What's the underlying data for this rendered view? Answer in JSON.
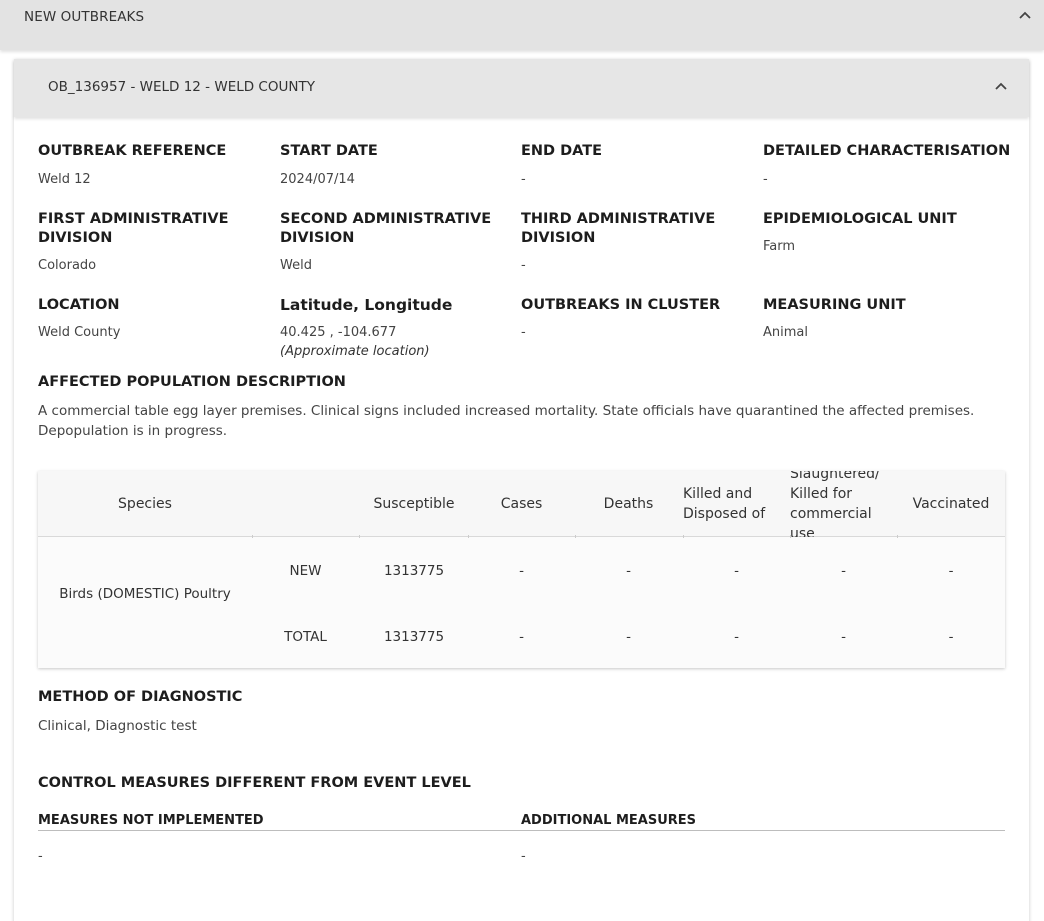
{
  "top_panel": {
    "title": "NEW OUTBREAKS",
    "icon": "chevron-up-icon"
  },
  "outbreak_panel": {
    "title": "OB_136957 - WELD 12 - WELD COUNTY",
    "icon": "chevron-up-icon"
  },
  "fields": {
    "outbreak_reference": {
      "label": "OUTBREAK REFERENCE",
      "value": "Weld 12"
    },
    "start_date": {
      "label": "START DATE",
      "value": "2024/07/14"
    },
    "end_date": {
      "label": "END DATE",
      "value": "-"
    },
    "detailed_characterisation": {
      "label": "DETAILED CHARACTERISATION",
      "value": "-"
    },
    "first_admin": {
      "label": "FIRST ADMINISTRATIVE DIVISION",
      "value": "Colorado"
    },
    "second_admin": {
      "label": "SECOND ADMINISTRATIVE DIVISION",
      "value": "Weld"
    },
    "third_admin": {
      "label": "THIRD ADMINISTRATIVE DIVISION",
      "value": "-"
    },
    "epi_unit": {
      "label": "EPIDEMIOLOGICAL UNIT",
      "value": "Farm"
    },
    "location": {
      "label": "LOCATION",
      "value": "Weld County"
    },
    "lat_long": {
      "label": "Latitude, Longitude",
      "value": "40.425 , -104.677",
      "note": "(Approximate location)"
    },
    "outbreaks_in_cluster": {
      "label": "OUTBREAKS IN CLUSTER",
      "value": "-"
    },
    "measuring_unit": {
      "label": "MEASURING UNIT",
      "value": "Animal"
    }
  },
  "affected_population": {
    "label": "AFFECTED POPULATION DESCRIPTION",
    "text": "A commercial table egg layer premises. Clinical signs included increased mortality. State officials have quarantined the affected premises. Depopulation is in progress."
  },
  "species_table": {
    "headers": {
      "species": "Species",
      "susceptible": "Susceptible",
      "cases": "Cases",
      "deaths": "Deaths",
      "killed": "Killed and Disposed of",
      "slaughtered": "Slaughtered/ Killed for commercial use",
      "vaccinated": "Vaccinated"
    },
    "species_name": "Birds (DOMESTIC) Poultry",
    "rows": [
      {
        "type": "NEW",
        "susceptible": "1313775",
        "cases": "-",
        "deaths": "-",
        "killed": "-",
        "slaughtered": "-",
        "vaccinated": "-"
      },
      {
        "type": "TOTAL",
        "susceptible": "1313775",
        "cases": "-",
        "deaths": "-",
        "killed": "-",
        "slaughtered": "-",
        "vaccinated": "-"
      }
    ]
  },
  "method_of_diagnostic": {
    "label": "METHOD OF DIAGNOSTIC",
    "value": "Clinical, Diagnostic test"
  },
  "control_measures": {
    "label": "CONTROL MEASURES DIFFERENT FROM EVENT LEVEL",
    "not_implemented": {
      "label": "MEASURES NOT IMPLEMENTED",
      "value": "-"
    },
    "additional": {
      "label": "ADDITIONAL MEASURES",
      "value": "-"
    }
  }
}
